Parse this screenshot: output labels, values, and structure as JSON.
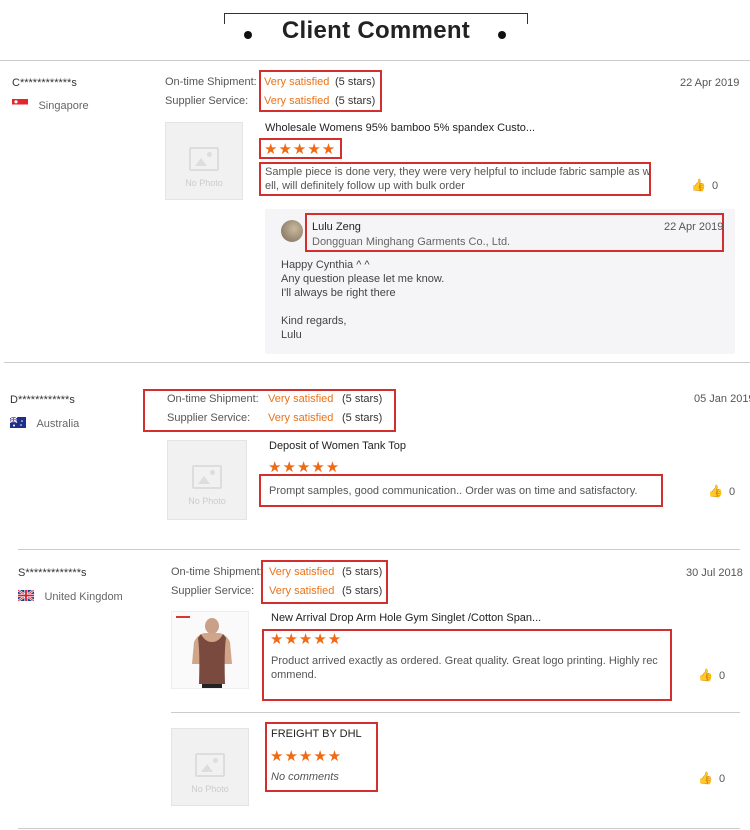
{
  "header": {
    "title": "Client Comment"
  },
  "labels": {
    "ontime": "On-time Shipment:",
    "supplier": "Supplier Service:"
  },
  "reviews": [
    {
      "name": "C************s",
      "country": "Singapore",
      "date": "22 Apr 2019",
      "ontime": "Very satisfied",
      "ontime_stars": "(5 stars)",
      "supplier": "Very satisfied",
      "supplier_stars": "(5 stars)",
      "product": "Wholesale Womens 95% bamboo 5% spandex Custo...",
      "stars": "★★★★★",
      "comment1": "Sample piece is done very, they were very helpful to include fabric sample as w",
      "comment2": "ell, will definitely follow up with bulk order",
      "likes": "0",
      "nophoto": "No Photo",
      "reply": {
        "name": "Lulu Zeng",
        "company": "Dongguan Minghang Garments Co., Ltd.",
        "date": "22 Apr 2019",
        "lines": [
          "Happy Cynthia ^ ^",
          "Any question please let me know.",
          "I'll always be right there",
          "",
          "Kind regards,",
          "Lulu"
        ]
      }
    },
    {
      "name": "D************s",
      "country": "Australia",
      "date": "05 Jan 2019",
      "ontime": "Very satisfied",
      "ontime_stars": "(5 stars)",
      "supplier": "Very satisfied",
      "supplier_stars": "(5 stars)",
      "product": "Deposit of Women Tank Top",
      "stars": "★★★★★",
      "comment": "Prompt samples, good communication.. Order was on time and satisfactory.",
      "likes": "0",
      "nophoto": "No Photo"
    },
    {
      "name": "S*************s",
      "country": "United Kingdom",
      "date": "30 Jul 2018",
      "ontime": "Very satisfied",
      "ontime_stars": "(5 stars)",
      "supplier": "Very satisfied",
      "supplier_stars": "(5 stars)",
      "product": "New Arrival Drop Arm Hole Gym Singlet /Cotton Span...",
      "stars": "★★★★★",
      "comment1": "Product arrived exactly as ordered. Great quality. Great logo printing. Highly rec",
      "comment2": "ommend.",
      "likes": "0",
      "item2": {
        "product": "FREIGHT BY DHL",
        "stars": "★★★★★",
        "comment": "No comments",
        "likes": "0",
        "nophoto": "No Photo"
      }
    }
  ],
  "colors": {
    "accent": "#e8731a",
    "star": "#f06a13",
    "highlight": "#d32f2f"
  },
  "icons": [
    "thumbs-up-icon",
    "no-photo-icon",
    "flag-singapore-icon",
    "flag-australia-icon",
    "flag-uk-icon"
  ]
}
